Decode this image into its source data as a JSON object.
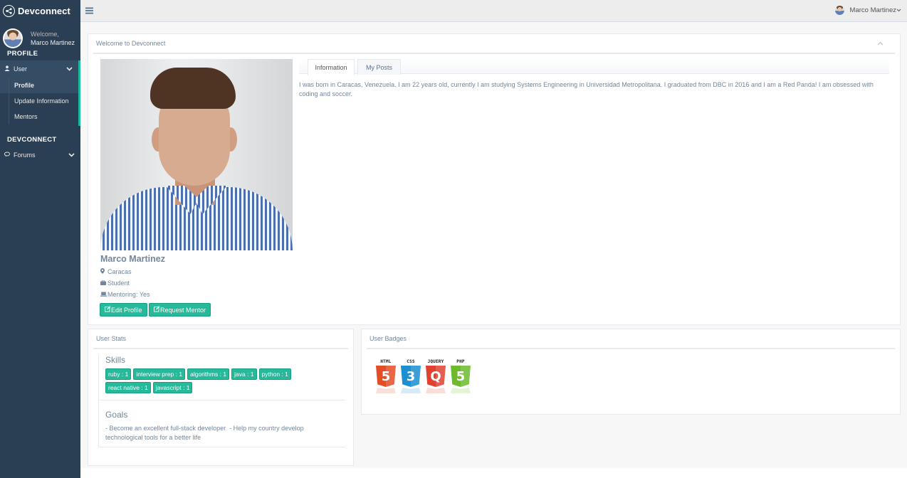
{
  "app": {
    "brand": "Devconnect"
  },
  "sidebar": {
    "welcome": "Welcome,",
    "user_name": "Marco Martinez",
    "section_profile": "PROFILE",
    "user_menu": {
      "label": "User",
      "icon": "user-icon"
    },
    "sub_items": [
      {
        "label": "Profile",
        "current": true
      },
      {
        "label": "Update Information"
      },
      {
        "label": "Mentors"
      }
    ],
    "section_dev": "DEVCONNECT",
    "forums_menu": {
      "label": "Forums",
      "icon": "comments-icon"
    }
  },
  "topbar": {
    "user_name": "Marco Martinez"
  },
  "main_panel": {
    "title": "Welcome to Devconnect",
    "profile": {
      "name": "Marco Martinez",
      "location": "Caracas",
      "occupation": "Student",
      "mentoring": "Mentoring: Yes"
    },
    "buttons": {
      "edit": "Edit Profile",
      "request": "Request Mentor"
    },
    "tabs": [
      {
        "label": "Information",
        "active": true
      },
      {
        "label": "My Posts"
      }
    ],
    "about": "I was born in Caracas, Venezuela. I am 22 years old, currently I am studying Systems Engineering in Universidad Metropolitana. I graduated from DBC in 2016 and I am a Red Panda! I am obsessed with coding and soccer."
  },
  "stats_panel": {
    "title": "User Stats",
    "skills_heading": "Skills",
    "skills": [
      "ruby : 1",
      "interview prep : 1",
      "algorithms : 1",
      "java : 1",
      "python : 1",
      "react native : 1",
      "javascript : 1"
    ],
    "goals_heading": "Goals",
    "goals_text": "- Become an excellent full-stack developer  - Help my country develop technological tools for a better life"
  },
  "badges_panel": {
    "title": "User Badges",
    "badges": [
      {
        "caption": "HTML",
        "number": "5",
        "color": "#e44d26"
      },
      {
        "caption": "CSS",
        "number": "3",
        "color": "#1b8fd2"
      },
      {
        "caption": "JQUERY",
        "number": "Q",
        "color": "#e1412f"
      },
      {
        "caption": "PHP",
        "number": "5",
        "color": "#6dbb2d"
      }
    ]
  },
  "colors": {
    "sidebar": "#2a3f54",
    "accent": "#26b99a",
    "text": "#73879c"
  }
}
